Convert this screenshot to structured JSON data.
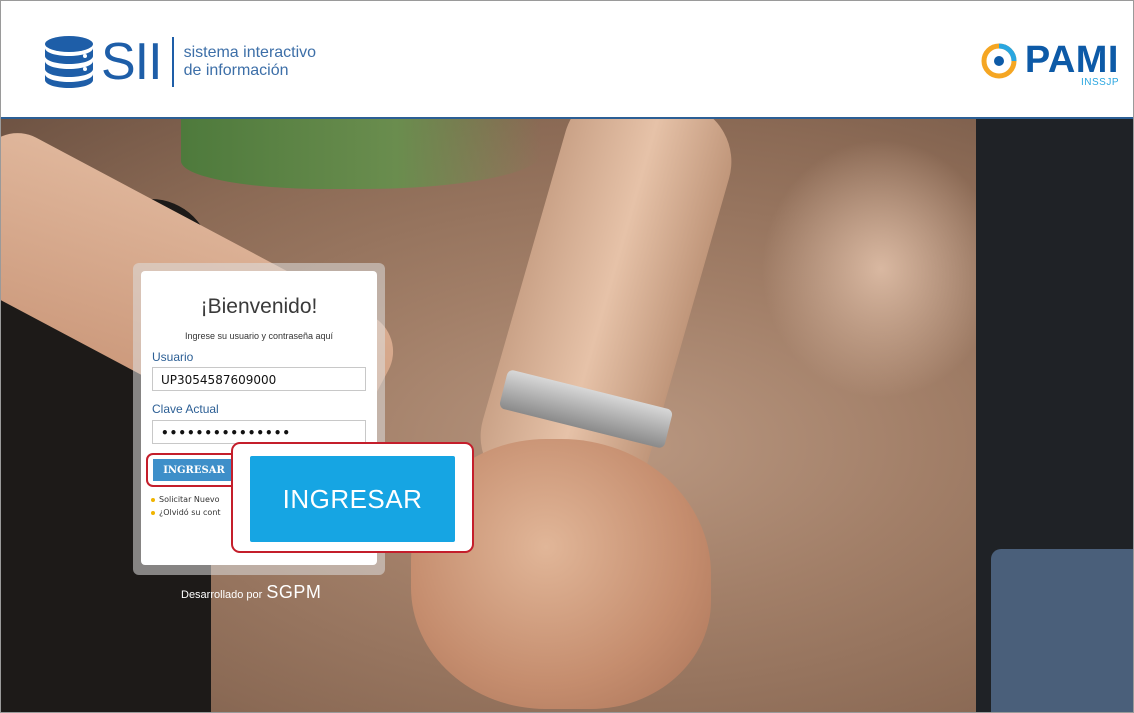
{
  "header": {
    "sii_logo_text": "SII",
    "sii_tagline_line1": "sistema interactivo",
    "sii_tagline_line2": "de información",
    "pami_logo_text": "PAMI",
    "pami_sub_text": "INSSJP"
  },
  "login": {
    "title": "¡Bienvenido!",
    "instructions": "Ingrese su usuario y contraseña aquí",
    "user_label": "Usuario",
    "user_value": "UP3054587609000",
    "password_label": "Clave Actual",
    "password_value": "•••••••••••••••",
    "submit_label": "INGRESAR",
    "link_new": "Solicitar Nuevo",
    "link_forgot": "¿Olvidó su cont"
  },
  "footer": {
    "developed_by": "Desarrollado por",
    "developer": "SGPM"
  },
  "callout": {
    "zoomed_label": "INGRESAR"
  },
  "colors": {
    "brand_blue": "#1e5ea8",
    "button_blue": "#16a5e3",
    "highlight_red": "#c41e2b"
  }
}
